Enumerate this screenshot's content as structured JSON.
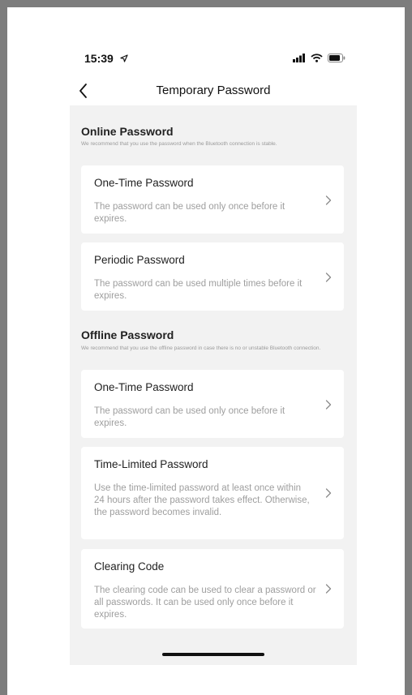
{
  "status": {
    "time": "15:39",
    "location_icon": "location-arrow-icon",
    "signal_icon": "signal-icon",
    "wifi_icon": "wifi-icon",
    "battery_icon": "battery-icon"
  },
  "nav": {
    "back_icon": "chevron-left-icon",
    "title": "Temporary Password"
  },
  "online": {
    "title": "Online Password",
    "desc": "We recommend that you use the password when the Bluetooth connection is stable.",
    "cards": [
      {
        "title": "One-Time Password",
        "desc": "The password can be used only once before it expires."
      },
      {
        "title": "Periodic Password",
        "desc": "The password can be used multiple times before it expires."
      }
    ]
  },
  "offline": {
    "title": "Offline Password",
    "desc": "We recommend that you use the offline password in case there is no or unstable Bluetooth connection.",
    "cards": [
      {
        "title": "One-Time Password",
        "desc": "The password can be used only once before it expires."
      },
      {
        "title": "Time-Limited Password",
        "desc": "Use the time-limited password at least once within 24 hours after the password takes effect. Otherwise, the password becomes invalid."
      },
      {
        "title": "Clearing Code",
        "desc": "The clearing code can be used to clear a password or all passwords. It can be used only once before it expires."
      }
    ]
  },
  "colors": {
    "background": "#f2f2f2",
    "card": "#ffffff",
    "secondary_text": "#9e9e9e"
  }
}
